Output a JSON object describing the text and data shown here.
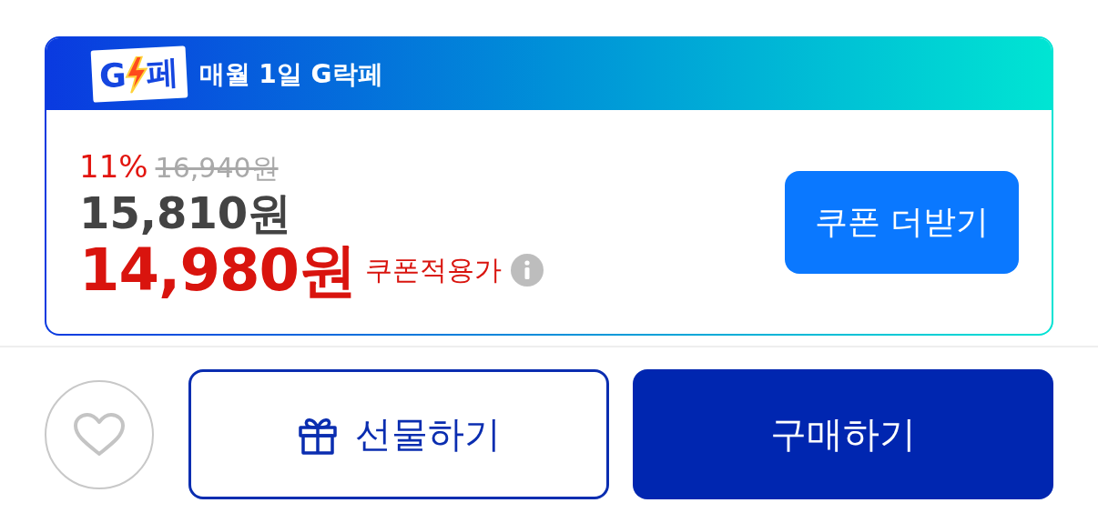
{
  "promo": {
    "logo_parts": [
      "G",
      "페"
    ],
    "title": "매월 1일 G락페"
  },
  "price": {
    "discount": "11%",
    "original_price": "16,940원",
    "sale_price": "15,810원",
    "coupon_price": "14,980원",
    "coupon_label": "쿠폰적용가"
  },
  "coupon_button": "쿠폰 더받기",
  "actions": {
    "wishlist": {
      "selected": false
    },
    "gift_button": "선물하기",
    "buy_button": "구매하기"
  }
}
